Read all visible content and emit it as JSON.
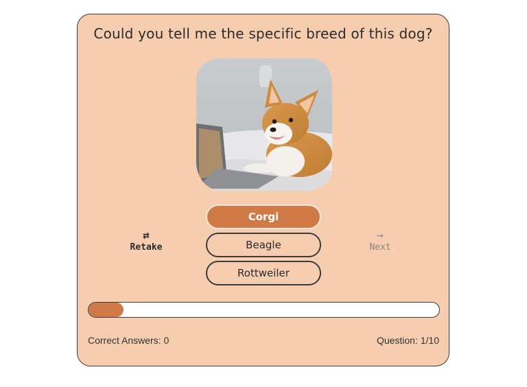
{
  "quiz": {
    "question": "Could you tell me the specific breed of this dog?",
    "answers": [
      {
        "label": "Corgi",
        "selected": true
      },
      {
        "label": "Beagle",
        "selected": false
      },
      {
        "label": "Rottweiler",
        "selected": false
      }
    ],
    "retake": {
      "label": "Retake",
      "icon": "repeat-icon"
    },
    "next": {
      "label": "Next",
      "icon": "arrow-right-icon",
      "enabled": false
    },
    "progress_fraction": 0.1,
    "correct_answers_label": "Correct Answers: 0",
    "question_counter_label": "Question: 1/10"
  },
  "colors": {
    "card_background": "#f7cdb0",
    "accent": "#d07a48",
    "border": "#3a3a3a",
    "disabled_text": "#8a8580"
  }
}
